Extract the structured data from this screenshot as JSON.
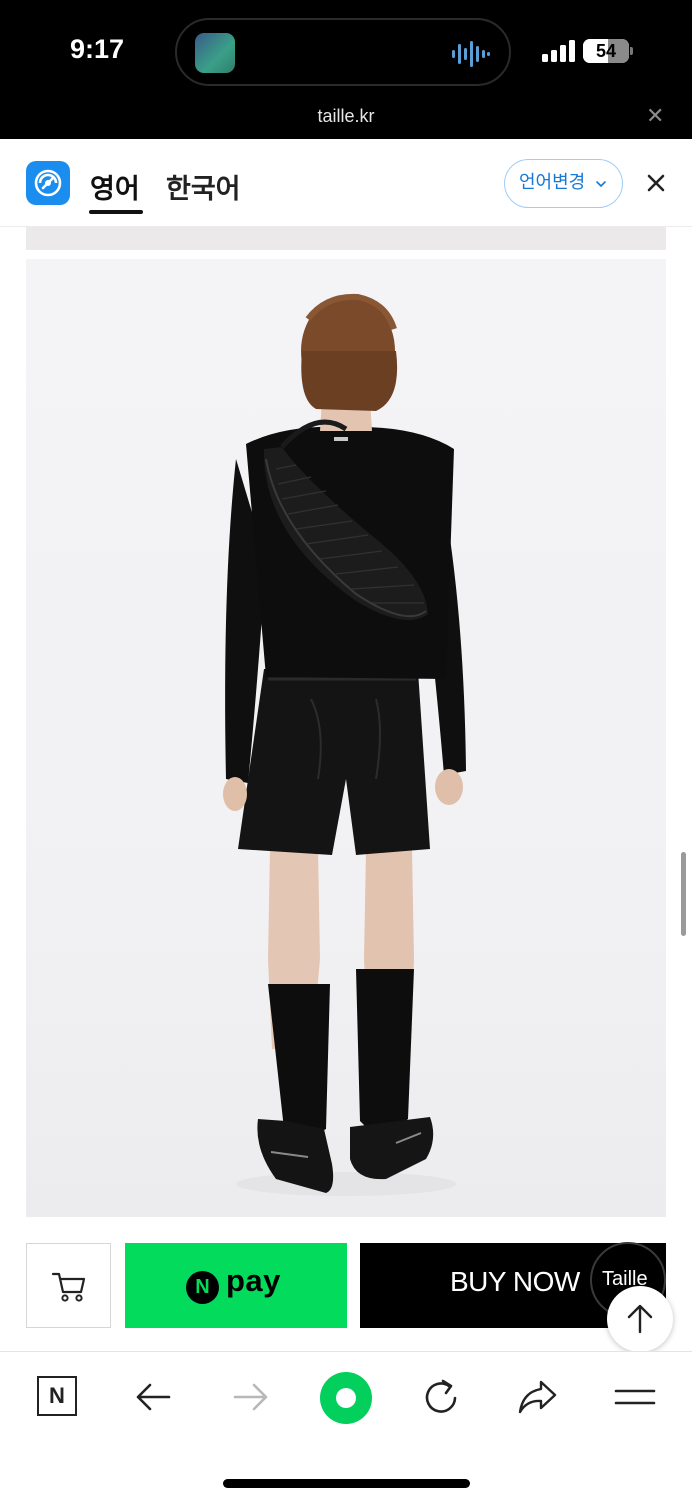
{
  "status_bar": {
    "time": "9:17",
    "battery": "54",
    "app_icon": "recording-app-icon",
    "audio_icon": "audio-waveform-icon",
    "signal_icon": "signal-bars-icon"
  },
  "url_bar": {
    "domain": "taille.kr",
    "close_icon": "close-icon"
  },
  "translate_bar": {
    "logo_icon": "translate-logo-icon",
    "tabs": [
      {
        "label": "영어",
        "active": true
      },
      {
        "label": "한국어",
        "active": false
      }
    ],
    "change_language_label": "언어변경",
    "chevron_icon": "chevron-down-icon",
    "close_icon": "close-icon"
  },
  "product": {
    "image": "product-photo-model-back-view"
  },
  "buy_bar": {
    "cart_icon": "cart-icon",
    "npay_badge": "N",
    "npay_label": "pay",
    "buy_now_label": "BUY NOW",
    "chat_label": "Taille",
    "scroll_top_icon": "arrow-up-icon"
  },
  "toolbar": {
    "home_label": "N",
    "items": [
      "naver-home-icon",
      "back-arrow-icon",
      "forward-arrow-icon",
      "green-dot-icon",
      "reload-icon",
      "share-icon",
      "menu-icon"
    ]
  },
  "colors": {
    "accent_blue": "#1b8dee",
    "naver_green": "#03db5c",
    "buy_now_bg": "#000000"
  }
}
